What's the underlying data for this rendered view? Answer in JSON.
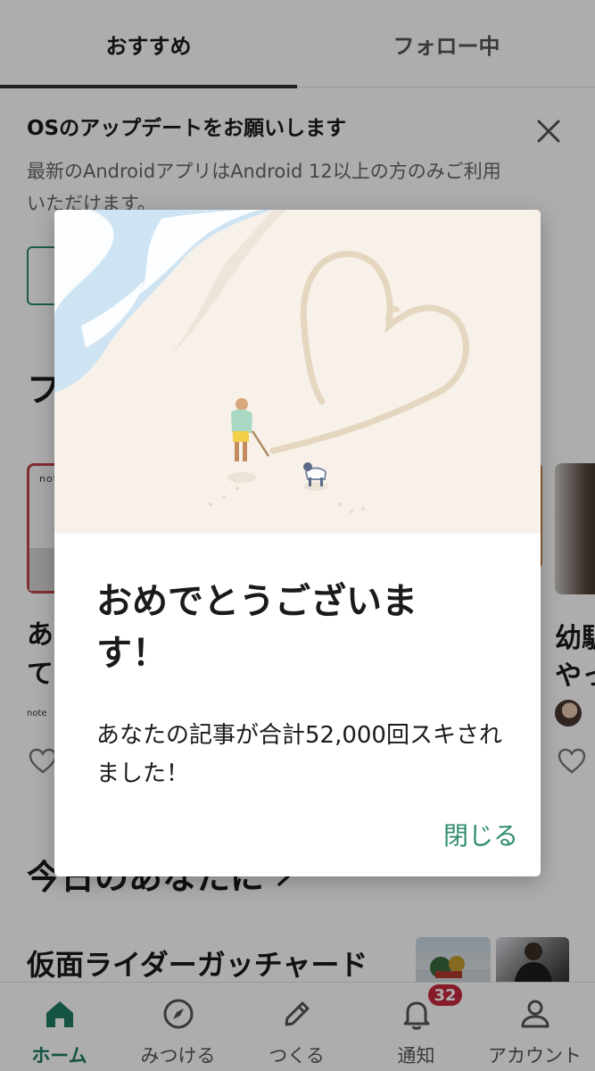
{
  "tabs": {
    "recommended": "おすすめ",
    "following": "フォロー中"
  },
  "banner": {
    "title": "OSのアップデートをお願いします",
    "body": "最新のAndroidアプリはAndroid 12以上の方のみご利用いただけます。",
    "close_icon": "close-icon"
  },
  "section_heading_cut": "フ",
  "cards": {
    "left": {
      "logo": "note",
      "line1": "あ",
      "line2": "て",
      "footer": "note"
    },
    "right": {
      "line1": "幼馴",
      "line2": "やっ"
    }
  },
  "section2": {
    "heading": "今日のあなたに",
    "chevron": "chevron-right-icon"
  },
  "article": {
    "title": "仮面ライダーガッチャード"
  },
  "bottom_nav": [
    {
      "label": "ホーム",
      "icon": "home-icon"
    },
    {
      "label": "みつける",
      "icon": "compass-icon"
    },
    {
      "label": "つくる",
      "icon": "pencil-icon"
    },
    {
      "label": "通知",
      "icon": "bell-icon"
    },
    {
      "label": "アカウント",
      "icon": "person-icon"
    }
  ],
  "notification_badge": "32",
  "dialog": {
    "title": "おめでとうございます！",
    "body": "あなたの記事が合計52,000回スキされました！",
    "close_label": "閉じる"
  },
  "colors": {
    "accent": "#2e8b6e",
    "badge": "#c8283d",
    "nav_active": "#1f7b63"
  }
}
